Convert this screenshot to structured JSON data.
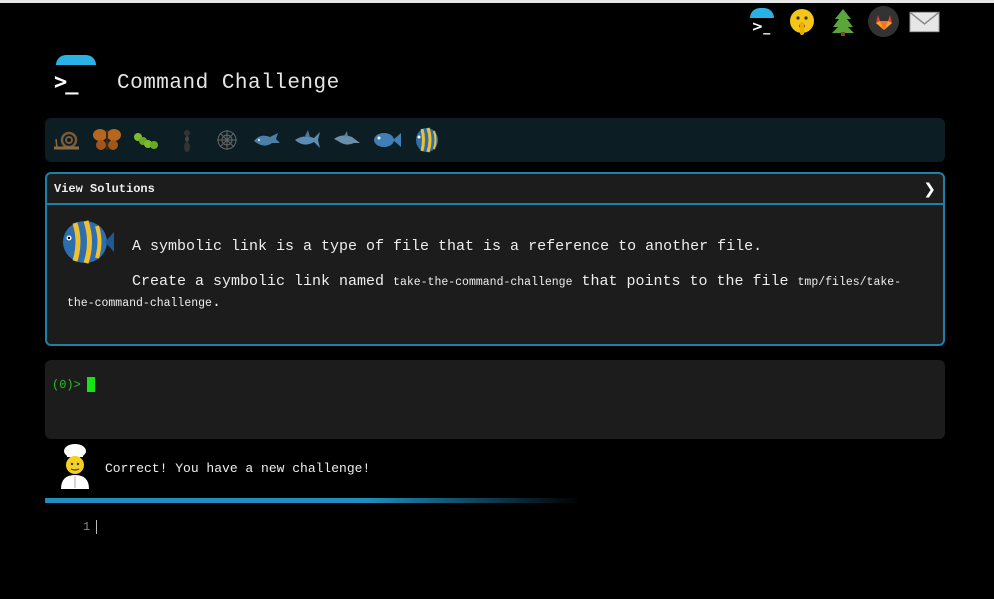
{
  "app": {
    "title": "Command Challenge"
  },
  "top_icons": [
    {
      "name": "command-challenge-logo-icon"
    },
    {
      "name": "shushing-face-icon"
    },
    {
      "name": "tree-icon"
    },
    {
      "name": "gitlab-icon"
    },
    {
      "name": "mail-icon"
    }
  ],
  "progress": {
    "creatures": [
      "snail-icon",
      "butterfly-icon",
      "caterpillar-icon",
      "ant-icon",
      "spider-web-icon",
      "whale-icon",
      "shark-icon",
      "dolphin-icon",
      "fish-icon",
      "tropical-fish-icon"
    ],
    "current": "tropical-fish-icon"
  },
  "panel": {
    "header_label": "View Solutions",
    "chevron": "❯",
    "description_1": "A symbolic link is a type of file that is a reference to another file.",
    "description_2_prefix": "Create a symbolic link named ",
    "link_name": "take-the-command-challenge",
    "description_2_middle": " that points to the file ",
    "target_path": "tmp/files/take-the-command-challenge",
    "description_2_suffix": "."
  },
  "terminal": {
    "prompt": "(0)>"
  },
  "message": {
    "text": "Correct! You have a new challenge!"
  },
  "editor": {
    "line_number": "1"
  },
  "colors": {
    "accent": "#1e7fa8",
    "prompt": "#22c322",
    "cursor": "#12e512",
    "dome": "#2ab2e6"
  }
}
